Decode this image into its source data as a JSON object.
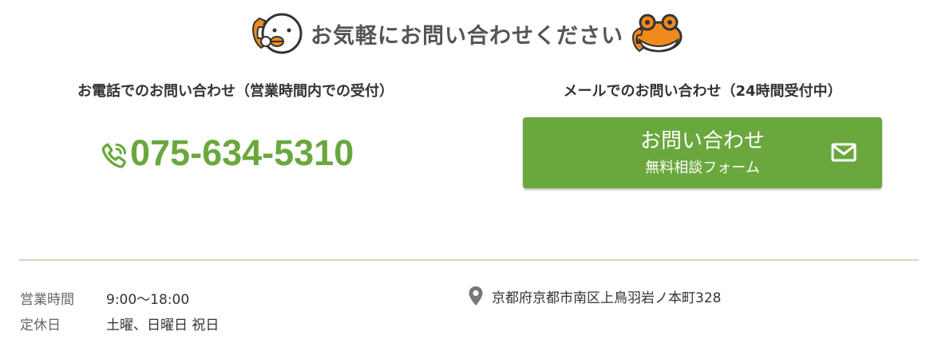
{
  "heading": {
    "title": "お気軽にお問い合わせください"
  },
  "phone_section": {
    "title": "お電話でのお問い合わせ（営業時間内での受付）",
    "number": "075-634-5310",
    "icon": "phone-icon"
  },
  "mail_section": {
    "title": "メールでのお問い合わせ（24時間受付中）",
    "button_main": "お問い合わせ",
    "button_sub": "無料相談フォーム",
    "icon": "mail-icon"
  },
  "info": {
    "hours_label": "営業時間",
    "hours_value": "9:00〜18:00",
    "closed_label": "定休日",
    "closed_value": "土曜、日曜日 祝日",
    "address": "京都府京都市南区上鳥羽岩ノ本町328",
    "address_icon": "location-pin-icon"
  },
  "colors": {
    "accent_green": "#6aa83e",
    "heading_gray": "#555555",
    "divider": "#d6d4c3",
    "mascot_orange": "#f08a1e"
  }
}
